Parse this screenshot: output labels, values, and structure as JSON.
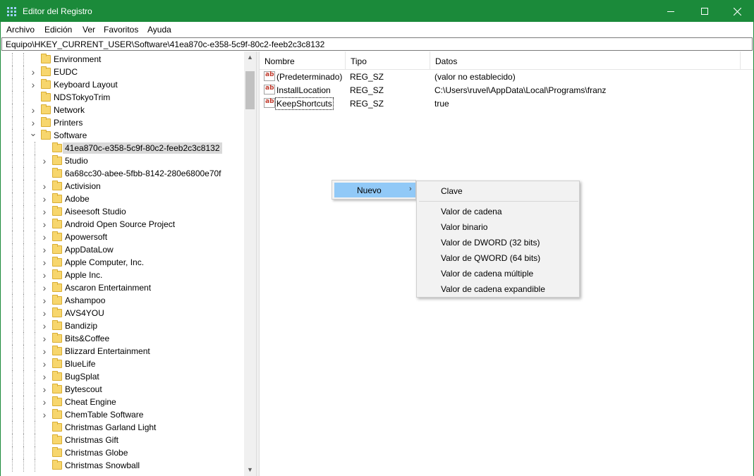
{
  "window": {
    "title": "Editor del Registro"
  },
  "menu": [
    "Archivo",
    "Edición",
    "Ver",
    "Favoritos",
    "Ayuda"
  ],
  "address": "Equipo\\HKEY_CURRENT_USER\\Software\\41ea870c-e358-5c9f-80c2-feeb2c3c8132",
  "tree": {
    "items": [
      {
        "label": "Environment",
        "level": 1,
        "expander": "none"
      },
      {
        "label": "EUDC",
        "level": 1,
        "expander": "collapsed"
      },
      {
        "label": "Keyboard Layout",
        "level": 1,
        "expander": "collapsed"
      },
      {
        "label": "NDSTokyoTrim",
        "level": 1,
        "expander": "none"
      },
      {
        "label": "Network",
        "level": 1,
        "expander": "collapsed"
      },
      {
        "label": "Printers",
        "level": 1,
        "expander": "collapsed"
      },
      {
        "label": "Software",
        "level": 1,
        "expander": "expanded"
      },
      {
        "label": "41ea870c-e358-5c9f-80c2-feeb2c3c8132",
        "level": 2,
        "expander": "none",
        "selected": true
      },
      {
        "label": "5tudio",
        "level": 2,
        "expander": "collapsed"
      },
      {
        "label": "6a68cc30-abee-5fbb-8142-280e6800e70f",
        "level": 2,
        "expander": "none"
      },
      {
        "label": "Activision",
        "level": 2,
        "expander": "collapsed"
      },
      {
        "label": "Adobe",
        "level": 2,
        "expander": "collapsed"
      },
      {
        "label": "Aiseesoft Studio",
        "level": 2,
        "expander": "collapsed"
      },
      {
        "label": "Android Open Source Project",
        "level": 2,
        "expander": "collapsed"
      },
      {
        "label": "Apowersoft",
        "level": 2,
        "expander": "collapsed"
      },
      {
        "label": "AppDataLow",
        "level": 2,
        "expander": "collapsed"
      },
      {
        "label": "Apple Computer, Inc.",
        "level": 2,
        "expander": "collapsed"
      },
      {
        "label": "Apple Inc.",
        "level": 2,
        "expander": "collapsed"
      },
      {
        "label": "Ascaron Entertainment",
        "level": 2,
        "expander": "collapsed"
      },
      {
        "label": "Ashampoo",
        "level": 2,
        "expander": "collapsed"
      },
      {
        "label": "AVS4YOU",
        "level": 2,
        "expander": "collapsed"
      },
      {
        "label": "Bandizip",
        "level": 2,
        "expander": "collapsed"
      },
      {
        "label": "Bits&Coffee",
        "level": 2,
        "expander": "collapsed"
      },
      {
        "label": "Blizzard Entertainment",
        "level": 2,
        "expander": "collapsed"
      },
      {
        "label": "BlueLife",
        "level": 2,
        "expander": "collapsed"
      },
      {
        "label": "BugSplat",
        "level": 2,
        "expander": "collapsed"
      },
      {
        "label": "Bytescout",
        "level": 2,
        "expander": "collapsed"
      },
      {
        "label": "Cheat Engine",
        "level": 2,
        "expander": "collapsed"
      },
      {
        "label": "ChemTable Software",
        "level": 2,
        "expander": "collapsed"
      },
      {
        "label": "Christmas Garland Light",
        "level": 2,
        "expander": "none"
      },
      {
        "label": "Christmas Gift",
        "level": 2,
        "expander": "none"
      },
      {
        "label": "Christmas Globe",
        "level": 2,
        "expander": "none"
      },
      {
        "label": "Christmas Snowball",
        "level": 2,
        "expander": "none"
      }
    ]
  },
  "list": {
    "columns": [
      "Nombre",
      "Tipo",
      "Datos"
    ],
    "rows": [
      {
        "name": "(Predeterminado)",
        "type": "REG_SZ",
        "data": "(valor no establecido)"
      },
      {
        "name": "InstallLocation",
        "type": "REG_SZ",
        "data": "C:\\Users\\ruvel\\AppData\\Local\\Programs\\franz"
      },
      {
        "name": "KeepShortcuts",
        "type": "REG_SZ",
        "data": "true",
        "focused": true
      }
    ],
    "icon_text": "ab"
  },
  "context_menu": {
    "parent_item": "Nuevo",
    "submenu": [
      "Clave",
      "Valor de cadena",
      "Valor binario",
      "Valor de DWORD (32 bits)",
      "Valor de QWORD (64 bits)",
      "Valor de cadena múltiple",
      "Valor de cadena expandible"
    ]
  },
  "colors": {
    "titlebar": "#1b8a3a",
    "highlight": "#91c9f7",
    "folder": "#f7d66d"
  }
}
